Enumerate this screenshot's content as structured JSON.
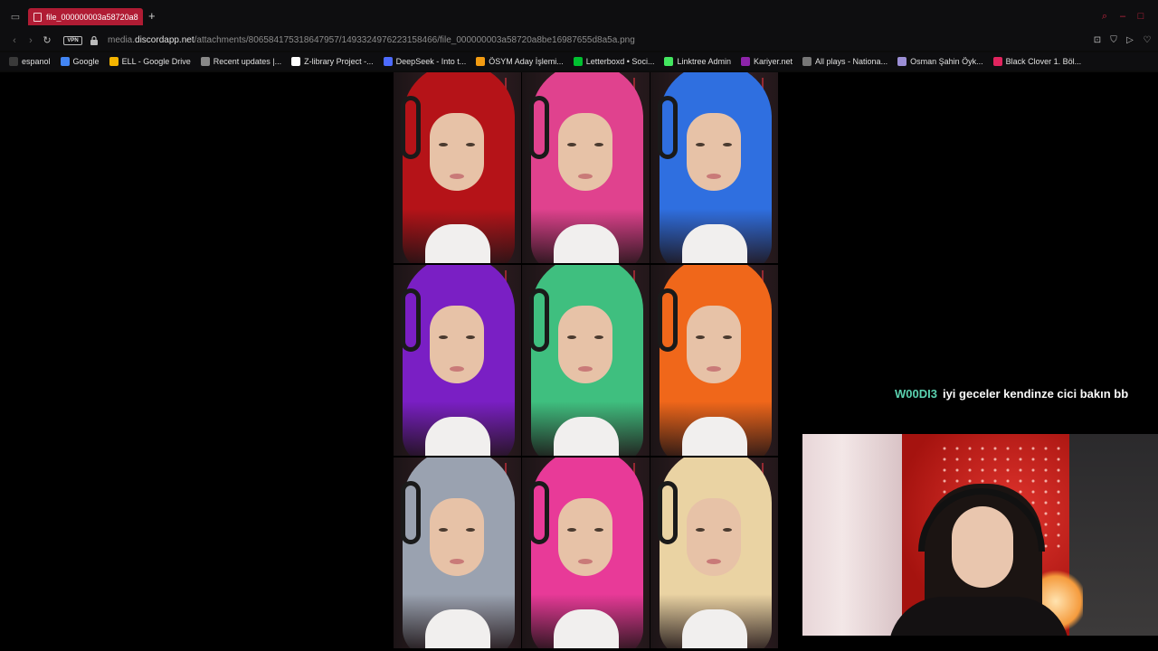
{
  "browser": {
    "tab_title": "file_000000003a58720a8",
    "url_prefix": "media.",
    "url_domain": "discordapp.net",
    "url_path": "/attachments/806584175318647957/1493324976223158466/file_000000003a58720a8be16987655d8a5a.png",
    "vpn_label": "VPN"
  },
  "bookmarks": [
    {
      "label": "espanol",
      "icon": "folder-icon",
      "color": "#3a3a3a"
    },
    {
      "label": "Google",
      "icon": "google-icon",
      "color": "#4285f4"
    },
    {
      "label": "ELL - Google Drive",
      "icon": "drive-icon",
      "color": "#f4b400"
    },
    {
      "label": "Recent updates |...",
      "icon": "page-icon",
      "color": "#888888"
    },
    {
      "label": "Z-library Project -...",
      "icon": "z-icon",
      "color": "#ffffff"
    },
    {
      "label": "DeepSeek - Into t...",
      "icon": "deepseek-icon",
      "color": "#4d6bfe"
    },
    {
      "label": "ÖSYM Aday İşlemi...",
      "icon": "osym-icon",
      "color": "#f39c12"
    },
    {
      "label": "Letterboxd • Soci...",
      "icon": "letterboxd-icon",
      "color": "#00c030"
    },
    {
      "label": "Linktree Admin",
      "icon": "linktree-icon",
      "color": "#43e660"
    },
    {
      "label": "Kariyer.net",
      "icon": "kariyer-icon",
      "color": "#8e24aa"
    },
    {
      "label": "All plays - Nationa...",
      "icon": "list-icon",
      "color": "#777777"
    },
    {
      "label": "Osman Şahin Öyk...",
      "icon": "page-icon",
      "color": "#9c8fd6"
    },
    {
      "label": "Black Clover 1. Böl...",
      "icon": "bc-icon",
      "color": "#e0245e"
    }
  ],
  "image_grid": {
    "hair_colors": [
      "#b51318",
      "#e0428e",
      "#2f6fe0",
      "#7a1fc4",
      "#3fbf7f",
      "#f0671a",
      "#9aa2b0",
      "#e83a98",
      "#ead3a3"
    ],
    "hair_names": [
      "red",
      "pink",
      "blue",
      "purple",
      "green",
      "orange",
      "silver",
      "magenta",
      "blonde"
    ]
  },
  "chat": {
    "username": "W00DI3",
    "message": "iyi geceler kendinze cici bakın bb",
    "username_color": "#5bd2b0"
  },
  "colors": {
    "accent": "#b01c34"
  }
}
